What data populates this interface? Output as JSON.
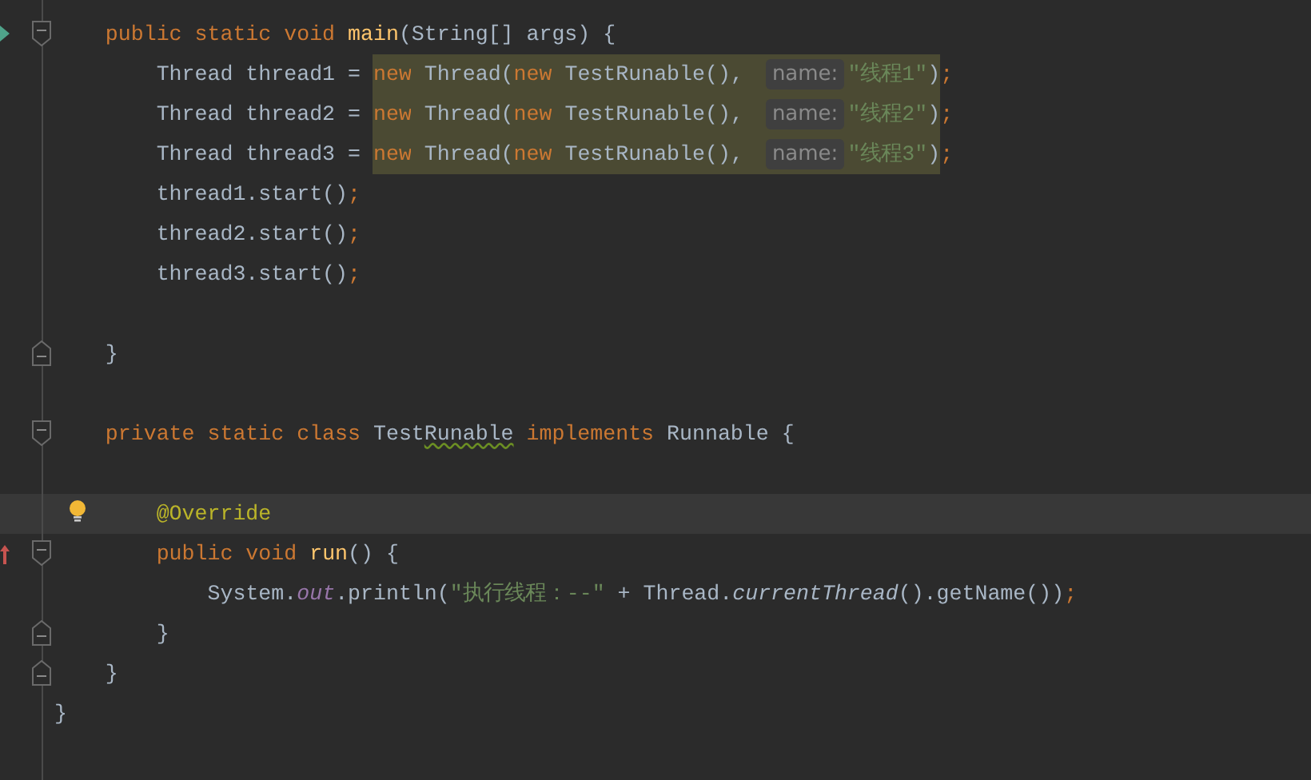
{
  "lines": [
    {
      "children": [
        {
          "current": false,
          "fold": {
            "kind": "start"
          },
          "marker": {
            "kind": "implements"
          },
          "tokens": [
            {
              "kind": "keyword",
              "text": "public static void "
            },
            {
              "kind": "method",
              "text": "main"
            },
            {
              "kind": "plain",
              "text": "(String[] args) {"
            }
          ],
          "children": [
            {
              "current": false,
              "tokens": [
                {
                  "kind": "plain",
                  "text": "Thread thread1 = "
                },
                {
                  "kind": "keyword",
                  "text": "new",
                  "highlighted": true
                },
                {
                  "kind": "plain",
                  "text": " Thread(",
                  "highlighted": true
                },
                {
                  "kind": "keyword",
                  "text": "new",
                  "highlighted": true
                },
                {
                  "kind": "plain",
                  "text": " TestRunable(),",
                  "highlighted": true
                },
                {
                  "kind": "hint",
                  "text": "name:",
                  "highlighted": true
                },
                {
                  "kind": "string",
                  "text": "\"线程1\"",
                  "highlighted": true
                },
                {
                  "kind": "plain",
                  "text": ")",
                  "highlighted": true
                },
                {
                  "kind": "punct",
                  "text": ";"
                }
              ]
            },
            {
              "current": false,
              "tokens": [
                {
                  "kind": "plain",
                  "text": "Thread thread2 = "
                },
                {
                  "kind": "keyword",
                  "text": "new",
                  "highlighted": true
                },
                {
                  "kind": "plain",
                  "text": " Thread(",
                  "highlighted": true
                },
                {
                  "kind": "keyword",
                  "text": "new",
                  "highlighted": true
                },
                {
                  "kind": "plain",
                  "text": " TestRunable(),",
                  "highlighted": true
                },
                {
                  "kind": "hint",
                  "text": "name:",
                  "highlighted": true
                },
                {
                  "kind": "string",
                  "text": "\"线程2\"",
                  "highlighted": true
                },
                {
                  "kind": "plain",
                  "text": ")",
                  "highlighted": true
                },
                {
                  "kind": "punct",
                  "text": ";"
                }
              ]
            },
            {
              "current": false,
              "tokens": [
                {
                  "kind": "plain",
                  "text": "Thread thread3 = "
                },
                {
                  "kind": "keyword",
                  "text": "new",
                  "highlighted": true
                },
                {
                  "kind": "plain",
                  "text": " Thread(",
                  "highlighted": true
                },
                {
                  "kind": "keyword",
                  "text": "new",
                  "highlighted": true
                },
                {
                  "kind": "plain",
                  "text": " TestRunable(),",
                  "highlighted": true
                },
                {
                  "kind": "hint",
                  "text": "name:",
                  "highlighted": true
                },
                {
                  "kind": "string",
                  "text": "\"线程3\"",
                  "highlighted": true
                },
                {
                  "kind": "plain",
                  "text": ")",
                  "highlighted": true
                },
                {
                  "kind": "punct",
                  "text": ";"
                }
              ]
            },
            {
              "current": false,
              "tokens": [
                {
                  "kind": "plain",
                  "text": "thread1.start()"
                },
                {
                  "kind": "punct",
                  "text": ";"
                }
              ]
            },
            {
              "current": false,
              "tokens": [
                {
                  "kind": "plain",
                  "text": "thread2.start()"
                },
                {
                  "kind": "punct",
                  "text": ";"
                }
              ]
            },
            {
              "current": false,
              "tokens": [
                {
                  "kind": "plain",
                  "text": "thread3.start()"
                },
                {
                  "kind": "punct",
                  "text": ";"
                }
              ]
            },
            {
              "current": false
            }
          ]
        },
        {
          "current": false,
          "fold": {
            "kind": "end"
          },
          "tokens": [
            {
              "kind": "plain",
              "text": "}"
            }
          ]
        },
        {
          "current": false
        },
        {
          "current": false,
          "fold": {
            "kind": "start"
          },
          "tokens": [
            {
              "kind": "keyword",
              "text": "private static class "
            },
            {
              "kind": "plain",
              "text": "Test"
            },
            {
              "kind": "typo",
              "text": "Runable"
            },
            {
              "kind": "keyword",
              "text": " implements"
            },
            {
              "kind": "plain",
              "text": " Runnable {"
            }
          ],
          "children": [
            {
              "current": false
            },
            {
              "current": true,
              "bulb": true,
              "tokens": [
                {
                  "kind": "annotation",
                  "text": "@Override"
                }
              ]
            },
            {
              "current": false,
              "fold": {
                "kind": "start"
              },
              "marker": {
                "kind": "overrides"
              },
              "tokens": [
                {
                  "kind": "keyword",
                  "text": "public void "
                },
                {
                  "kind": "method",
                  "text": "run"
                },
                {
                  "kind": "plain",
                  "text": "() {"
                }
              ],
              "children": [
                {
                  "current": false,
                  "tokens": [
                    {
                      "kind": "plain",
                      "text": "System."
                    },
                    {
                      "kind": "field",
                      "text": "out"
                    },
                    {
                      "kind": "plain",
                      "text": ".println("
                    },
                    {
                      "kind": "string",
                      "text": "\"执行线程：--\""
                    },
                    {
                      "kind": "plain",
                      "text": " + Thread."
                    },
                    {
                      "kind": "static-call",
                      "text": "currentThread"
                    },
                    {
                      "kind": "plain",
                      "text": "().getName())"
                    },
                    {
                      "kind": "punct",
                      "text": ";"
                    }
                  ]
                }
              ]
            },
            {
              "current": false,
              "fold": {
                "kind": "end"
              },
              "tokens": [
                {
                  "kind": "plain",
                  "text": "}"
                }
              ]
            }
          ]
        },
        {
          "current": false,
          "fold": {
            "kind": "end"
          },
          "tokens": [
            {
              "kind": "plain",
              "text": "}"
            }
          ]
        }
      ]
    },
    {
      "current": false,
      "tokens": [
        {
          "kind": "plain",
          "text": "}"
        }
      ]
    },
    {
      "current": false
    }
  ]
}
